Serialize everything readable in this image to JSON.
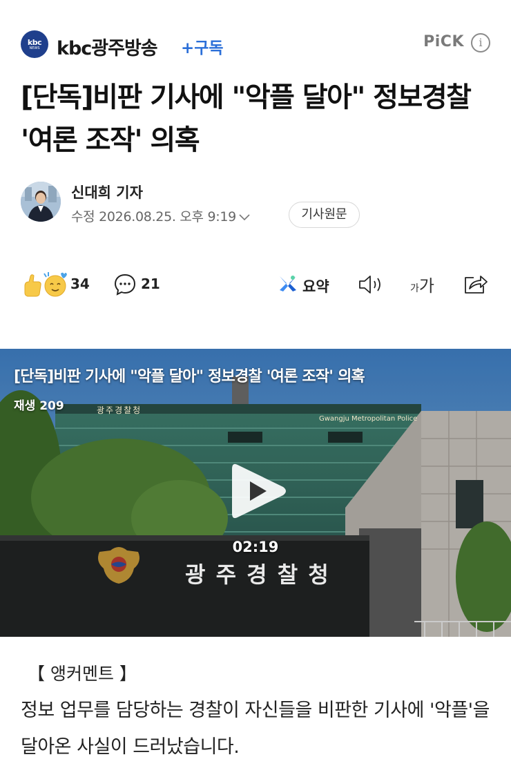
{
  "press": {
    "logo_line1": "kbc",
    "logo_line2": "NEWS",
    "name": "kbc광주방송",
    "subscribe_label": "+구독",
    "pick_label": "PiCK",
    "info_glyph": "i"
  },
  "article": {
    "title": "[단독]비판 기사에 \"악플 달아\" 정보경찰 '여론 조작' 의혹",
    "reporter": "신대희 기자",
    "modified": "수정 2026.08.25. 오후 9:19",
    "original_button": "기사원문"
  },
  "actions": {
    "reaction_count": "34",
    "comment_count": "21",
    "summary_label": "요약",
    "fontsize_small": "가",
    "fontsize_large": "가"
  },
  "video": {
    "title": "[단독]비판 기사에 \"악플 달아\" 정보경찰 '여론 조작' 의혹",
    "views": "재생 209",
    "duration": "02:19",
    "building_sign": "광 주 경 찰 청",
    "building_sign_top": "광주경찰청",
    "building_sign_en": "Gwangju Metropolitan Police"
  },
  "body": {
    "anchor": "【 앵커멘트 】",
    "text": "정보 업무를 담당하는 경찰이 자신들을 비판한 기사에 '악플'을 달아온 사실이 드러났습니다."
  },
  "colors": {
    "accent": "#2b6fd8",
    "logo": "#1f3f8c",
    "muted": "#666666"
  },
  "icons": [
    "info-icon",
    "chevron-down-icon",
    "reaction-emoji-icon",
    "comment-icon",
    "summary-icon",
    "speaker-icon",
    "font-size-icon",
    "share-icon",
    "play-icon"
  ]
}
